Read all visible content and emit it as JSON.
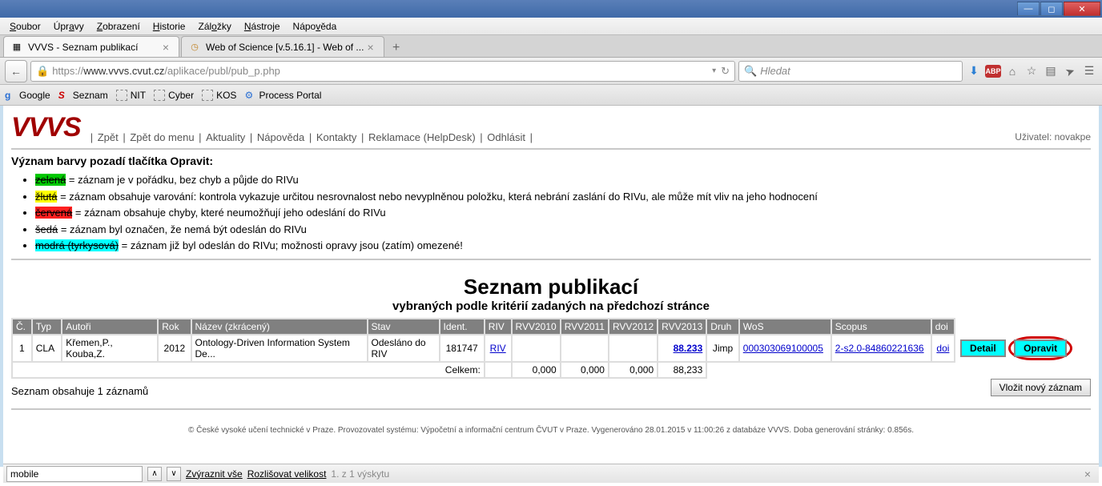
{
  "menubar": [
    "Soubor",
    "Úpravy",
    "Zobrazení",
    "Historie",
    "Záložky",
    "Nástroje",
    "Nápověda"
  ],
  "tabs": [
    {
      "title": "VVVS - Seznam publikací",
      "active": true
    },
    {
      "title": "Web of Science [v.5.16.1] - Web of ...",
      "active": false
    }
  ],
  "url": {
    "prefix": "https://",
    "host": "www.vvvs.cvut.cz",
    "path": "/aplikace/publ/pub_p.php"
  },
  "search_placeholder": "Hledat",
  "bookmarks": [
    "Google",
    "Seznam",
    "NIT",
    "Cyber",
    "KOS",
    "Process Portal"
  ],
  "logo": "VVVS",
  "topnav": [
    "Zpět",
    "Zpět do menu",
    "Aktuality",
    "Nápověda",
    "Kontakty",
    "Reklamace (HelpDesk)",
    "Odhlásit"
  ],
  "user_label": "Uživatel: novakpe",
  "legend_title": "Význam barvy pozadí tlačítka Opravit:",
  "legend": [
    {
      "label": "zelená",
      "cls": "hl-green",
      "text": " = záznam je v pořádku, bez chyb a půjde do RIVu"
    },
    {
      "label": "žlutá",
      "cls": "hl-yellow",
      "text": " = záznam obsahuje varování: kontrola vykazuje určitou nesrovnalost nebo nevyplněnou položku, která nebrání zaslání do RIVu, ale může mít vliv na jeho hodnocení"
    },
    {
      "label": "červená",
      "cls": "hl-red",
      "text": " = záznam obsahuje chyby, které neumožňují jeho odeslání do RIVu"
    },
    {
      "label": "šedá",
      "cls": "hl-gray",
      "text": " = záznam byl označen, že nemá být odeslán do RIVu"
    },
    {
      "label": "modrá (tyrkysová)",
      "cls": "hl-cyan",
      "text": " = záznam již byl odeslán do RIVu; možnosti opravy jsou (zatím) omezené!"
    }
  ],
  "main_title": "Seznam publikací",
  "sub_title": "vybraných podle kritérií zadaných na předchozí stránce",
  "columns": [
    "Č.",
    "Typ",
    "Autoři",
    "Rok",
    "Název (zkrácený)",
    "Stav",
    "Ident.",
    "RIV",
    "RVV2010",
    "RVV2011",
    "RVV2012",
    "RVV2013",
    "Druh",
    "WoS",
    "Scopus",
    "doi"
  ],
  "row": {
    "num": "1",
    "typ": "CLA",
    "autori": "Křemen,P., Kouba,Z.",
    "rok": "2012",
    "nazev": "Ontology-Driven Information System De...",
    "stav": "Odesláno do RIV",
    "ident": "181747",
    "riv": "RIV",
    "rvv2010": "",
    "rvv2011": "",
    "rvv2012": "",
    "rvv2013": "88.233",
    "druh": "Jimp",
    "wos": "000303069100005",
    "scopus": "2-s2.0-84860221636",
    "doi": "doi"
  },
  "totals": {
    "label": "Celkem:",
    "r2010": "0,000",
    "r2011": "0,000",
    "r2012": "0,000",
    "r2013": "88,233"
  },
  "btn_detail": "Detail",
  "btn_edit": "Opravit",
  "count_text": "Seznam obsahuje 1 záznamů",
  "btn_new": "Vložit nový záznam",
  "footer": "© České vysoké učení technické v Praze. Provozovatel systému: Výpočetní a informační centrum ČVUT v Praze. Vygenerováno 28.01.2015 v 11:00:26 z databáze VVVS. Doba generování stránky: 0.856s.",
  "find": {
    "value": "mobile",
    "highlight": "Zvýraznit vše",
    "case": "Rozlišovat velikost",
    "count": "1. z 1 výskytu"
  }
}
